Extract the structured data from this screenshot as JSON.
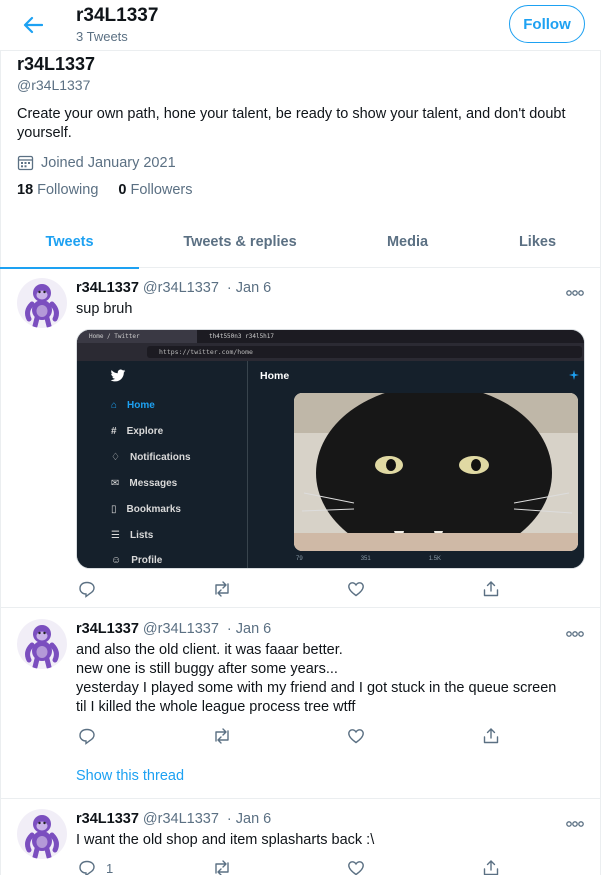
{
  "header": {
    "title": "r34L1337",
    "subtitle": "3 Tweets",
    "follow_label": "Follow"
  },
  "profile": {
    "name": "r34L1337",
    "handle": "@r34L1337",
    "bio": "Create your own path, hone your talent, be ready to show your talent, and don't doubt yourself.",
    "joined": "Joined January 2021",
    "following_count": "18",
    "following_label": "Following",
    "followers_count": "0",
    "followers_label": "Followers"
  },
  "tabs": [
    {
      "label": "Tweets",
      "active": true
    },
    {
      "label": "Tweets & replies",
      "active": false
    },
    {
      "label": "Media",
      "active": false
    },
    {
      "label": "Likes",
      "active": false
    }
  ],
  "tweets": [
    {
      "name": "r34L1337",
      "handle": "@r34L1337",
      "sep": "·",
      "date": "Jan 6",
      "text": "sup bruh",
      "reply_count": "",
      "media": {
        "browser_tabs": [
          "Home / Twitter",
          "th4t550n3 r34l5h17"
        ],
        "url": "https://twitter.com/home",
        "nav_items": [
          "Home",
          "Explore",
          "Notifications",
          "Messages",
          "Bookmarks",
          "Lists",
          "Profile"
        ],
        "main_title": "Home",
        "stats": [
          "79",
          "351",
          "1.5K"
        ]
      }
    },
    {
      "name": "r34L1337",
      "handle": "@r34L1337",
      "sep": "·",
      "date": "Jan 6",
      "lines": [
        "and also the old client. it was faaar better.",
        "new one is still buggy after some years...",
        "yesterday I played some with my friend and I got stuck in the queue screen",
        "til I killed the whole league process tree wtff"
      ],
      "reply_count": "",
      "thread_link": "Show this thread"
    },
    {
      "name": "r34L1337",
      "handle": "@r34L1337",
      "sep": "·",
      "date": "Jan 6",
      "text": "I want the old shop and item splasharts back :\\",
      "reply_count": "1"
    }
  ],
  "colors": {
    "accent": "#1da1f2",
    "secondary_text": "#5b7083",
    "divider": "#ebeef0",
    "avatar_purple": "#7b4fbf"
  }
}
